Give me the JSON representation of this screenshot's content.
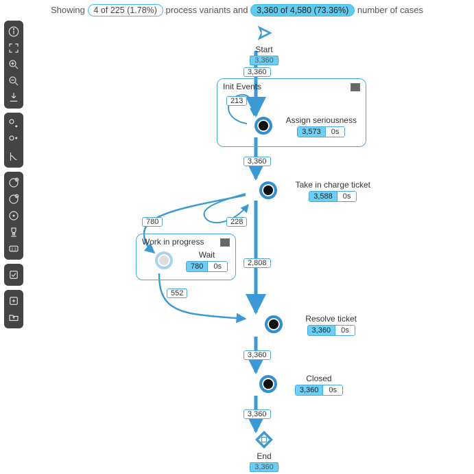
{
  "summary": {
    "prefix": "Showing",
    "variant_badge": "4 of 225 (1.78%)",
    "mid": "process variants and",
    "case_badge": "3,360 of 4,580 (73.36%)",
    "suffix": "number of cases"
  },
  "toolbar": {
    "groups": [
      [
        "info-icon",
        "fit-icon",
        "zoom-in-icon",
        "zoom-out-icon",
        "download-svg-icon"
      ],
      [
        "node-a-icon",
        "node-b-icon",
        "branch-icon"
      ],
      [
        "layer-add-icon",
        "layer-remove-icon",
        "layer-view-icon",
        "trophy-icon",
        "count-23-icon"
      ],
      [
        "checkbox-icon"
      ],
      [
        "add-panel-icon",
        "folder-out-icon"
      ]
    ]
  },
  "nodes": {
    "start": {
      "label": "Start",
      "count": "3,360"
    },
    "end": {
      "label": "End",
      "count": "3,360"
    },
    "group_init": {
      "title": "Init Events"
    },
    "group_wip": {
      "title": "Work in progress"
    },
    "assign": {
      "label": "Assign seriousness",
      "count": "3,573",
      "time": "0s"
    },
    "take": {
      "label": "Take in charge ticket",
      "count": "3,588",
      "time": "0s"
    },
    "wait": {
      "label": "Wait",
      "count": "780",
      "time": "0s"
    },
    "resolve": {
      "label": "Resolve ticket",
      "count": "3,360",
      "time": "0s"
    },
    "closed": {
      "label": "Closed",
      "count": "3,360",
      "time": "0s"
    }
  },
  "edges": {
    "start_assign": "3,360",
    "assign_self": "213",
    "assign_take": "3,360",
    "take_wait": "780",
    "take_back": "228",
    "take_resolve": "2,808",
    "wait_resolve": "552",
    "resolve_closed": "3,360",
    "closed_end": "3,360"
  }
}
